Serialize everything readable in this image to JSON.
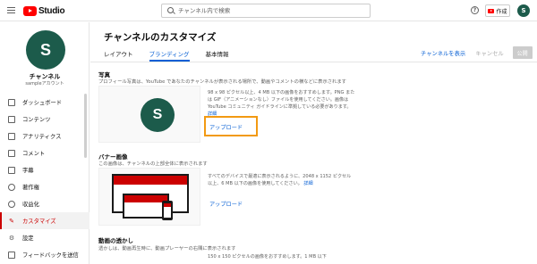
{
  "topbar": {
    "logo_text": "Studio",
    "search_placeholder": "チャンネル内で検索",
    "help_symbol": "?",
    "create_label": "作成",
    "avatar_letter": "S"
  },
  "sidebar": {
    "avatar_letter": "S",
    "channel_name": "チャンネル",
    "channel_sub": "sampleアカウント",
    "items": [
      {
        "label": "ダッシュボード",
        "icon": "dashboard-icon",
        "active": false
      },
      {
        "label": "コンテンツ",
        "icon": "content-icon",
        "active": false
      },
      {
        "label": "アナリティクス",
        "icon": "analytics-icon",
        "active": false
      },
      {
        "label": "コメント",
        "icon": "comments-icon",
        "active": false
      },
      {
        "label": "字幕",
        "icon": "subtitles-icon",
        "active": false
      },
      {
        "label": "著作権",
        "icon": "copyright-icon",
        "active": false
      },
      {
        "label": "収益化",
        "icon": "monetization-icon",
        "active": false
      },
      {
        "label": "カスタマイズ",
        "icon": "customize-icon",
        "active": true
      },
      {
        "label": "設定",
        "icon": "settings-icon",
        "active": false
      },
      {
        "label": "フィードバックを送信",
        "icon": "feedback-icon",
        "active": false
      }
    ]
  },
  "main": {
    "title": "チャンネルのカスタマイズ",
    "tabs": [
      {
        "label": "レイアウト",
        "active": false
      },
      {
        "label": "ブランディング",
        "active": true
      },
      {
        "label": "基本情報",
        "active": false
      }
    ],
    "view_channel": "チャンネルを表示",
    "cancel": "キャンセル",
    "publish": "公開",
    "photo": {
      "title": "写真",
      "description": "プロフィール写真は、YouTube であなたのチャンネルが表示される場所で、動画やコメントの横などに表示されます",
      "avatar_letter": "S",
      "requirements": "98 x 98 ピクセル以上、4 MB 以下の画像をおすすめします。PNG または GIF（アニメーションなし）ファイルを使用してください。画像は YouTube コミュニティ ガイドラインに準拠している必要があります。",
      "details": "詳細",
      "upload": "アップロード"
    },
    "banner": {
      "title": "バナー画像",
      "description": "この画像は、チャンネルの上部全体に表示されます",
      "requirements": "すべてのデバイスで最適に表示されるように、2048 x 1152 ピクセル以上、6 MB 以下の画像を使用してください。",
      "details": "詳細",
      "upload": "アップロード"
    },
    "watermark": {
      "title": "動画の透かし",
      "description": "透かしは、動画再生時に、動画プレーヤーの右隅に表示されます",
      "requirements": "150 x 150 ピクセルの画像をおすすめします。1 MB 以下"
    }
  },
  "colors": {
    "brand_red": "#ff0000",
    "link_blue": "#065fd4",
    "avatar_green": "#1c5b4b",
    "highlight_orange": "#f29a12",
    "active_red": "#cc0000"
  }
}
